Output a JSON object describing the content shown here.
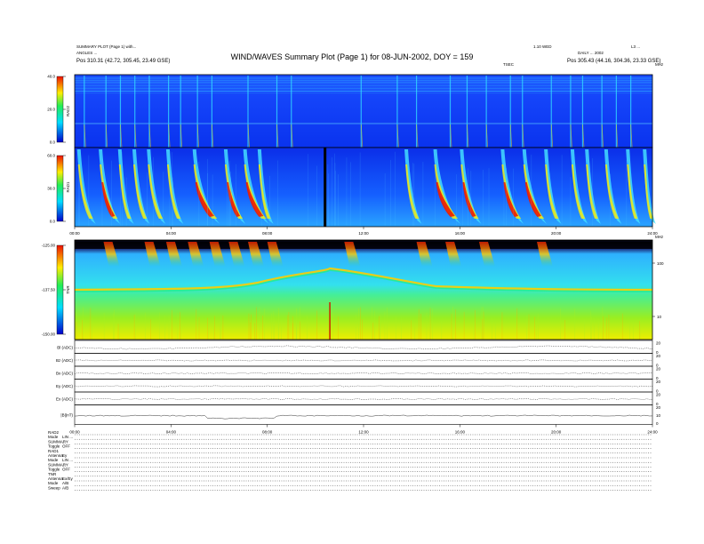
{
  "header": {
    "title": "WIND/WAVES Summary Plot (Page 1) for 08-JUN-2002, DOY = 159",
    "left_line1": "SUMMARY PLOT (Page 1) with...",
    "left_line2": "ANGLES ...",
    "left_line3": "Pos  310.31 (42.72, 305.45, 23.49 GSE)",
    "right_line1": "1.10 WED",
    "right_line2": "L3 ...",
    "right_line3": "DAILY ... 2002",
    "right_line4": "Pos  305.43 (44.16, 304.36, 23.33 GSE)",
    "rad2_units": "TSEC",
    "rad2_right": "MHz",
    "tnr_right": "MHz"
  },
  "chart_data": [
    {
      "type": "heatmap",
      "name": "RAD2",
      "ylabel": "RAD2",
      "yticks": [
        "40.0",
        "20.0",
        "0.0"
      ],
      "ylim": [
        0,
        40
      ]
    },
    {
      "type": "heatmap",
      "name": "RAD1",
      "ylabel": "RAD1",
      "yticks": [
        "60.0",
        "30.0",
        "0.0"
      ],
      "ylim": [
        0,
        60
      ],
      "xticks": [
        "00:00",
        "04:00",
        "08:00",
        "12:00",
        "16:00",
        "20:00",
        "24:00"
      ],
      "data_gap_hour": 10.4
    },
    {
      "type": "heatmap",
      "name": "TNR",
      "ylabel": "TNR",
      "yticks": [
        "-125.00",
        "-137.50",
        "-150.00"
      ],
      "ylim": [
        -150,
        -125
      ],
      "right_ticks": [
        "100",
        "10"
      ],
      "burst_hours": [
        1.2,
        2.9,
        3.8,
        4.7,
        5.6,
        6.4,
        7.2,
        8.0,
        11.2,
        14.2,
        15.4,
        16.8,
        19.2
      ]
    },
    {
      "type": "line",
      "name": "housekeeping",
      "panels": [
        {
          "label": "Bl (ADC)",
          "right_ticks": [
            "20",
            "0"
          ]
        },
        {
          "label": "Bz (ADC)",
          "right_ticks": [
            "20",
            "0"
          ]
        },
        {
          "label": "Bx (ADC)",
          "right_ticks": [
            "20",
            "0"
          ]
        },
        {
          "label": "Ey (ADC)",
          "right_ticks": [
            "20",
            "0"
          ]
        },
        {
          "label": "Ex (ADC)",
          "right_ticks": [
            "20",
            "0"
          ]
        },
        {
          "label": "|B|(nT)",
          "right_ticks": [
            "20",
            "10",
            "0"
          ]
        }
      ],
      "xticks": [
        "00:00",
        "04:00",
        "08:00",
        "12:00",
        "16:00",
        "20:00",
        "24:00"
      ]
    }
  ],
  "footer": {
    "rows": [
      {
        "label": "RAD2",
        "value": ""
      },
      {
        "label": "Mode",
        "value": "LIN ..."
      },
      {
        "label": "SUMMARY",
        "value": "..."
      },
      {
        "label": "Toggle",
        "value": "OFF"
      },
      {
        "label": "RAD1",
        "value": ""
      },
      {
        "label": "Antenna",
        "value": "Ey"
      },
      {
        "label": "Mode",
        "value": "LIN ..."
      },
      {
        "label": "SUMMARY",
        "value": "..."
      },
      {
        "label": "Toggle",
        "value": "OFF"
      },
      {
        "label": "TNR",
        "value": ""
      },
      {
        "label": "Antenna",
        "value": "Ex/Ey"
      },
      {
        "label": "Mode",
        "value": "A/B"
      },
      {
        "label": "Sweep",
        "value": "A/B"
      }
    ]
  }
}
